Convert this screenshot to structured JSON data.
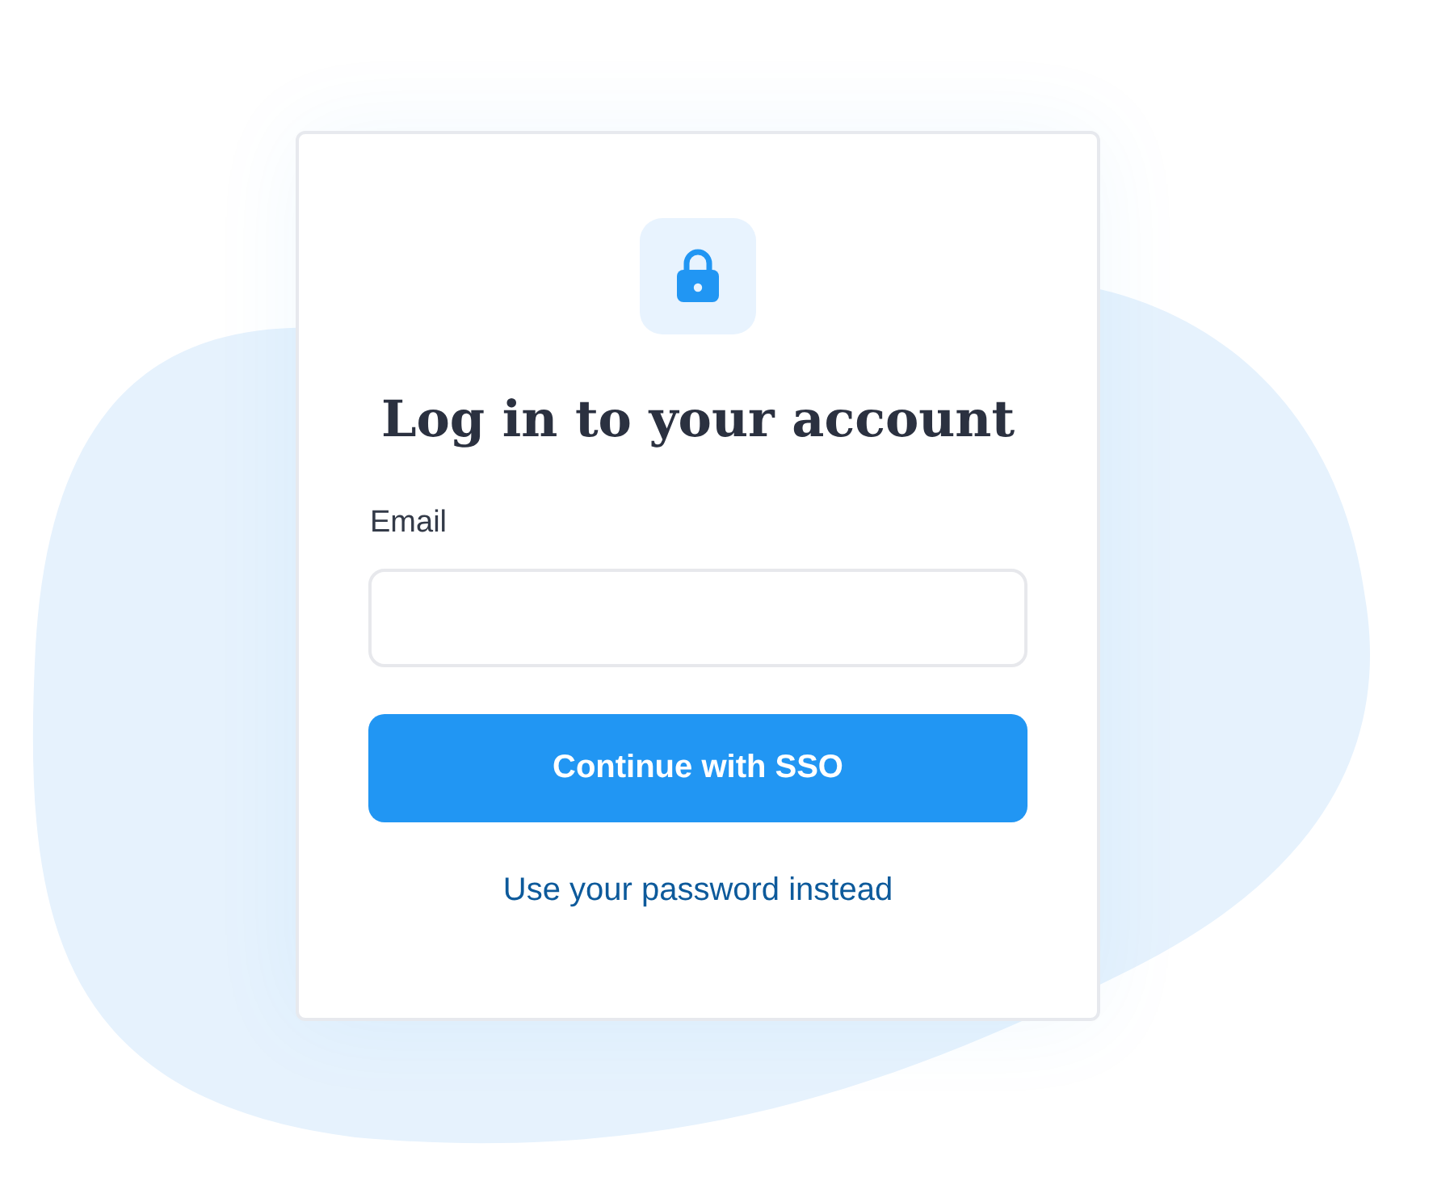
{
  "title": "Log in to your account",
  "email": {
    "label": "Email"
  },
  "primary_button": "Continue with SSO",
  "secondary_link": "Use your password instead"
}
